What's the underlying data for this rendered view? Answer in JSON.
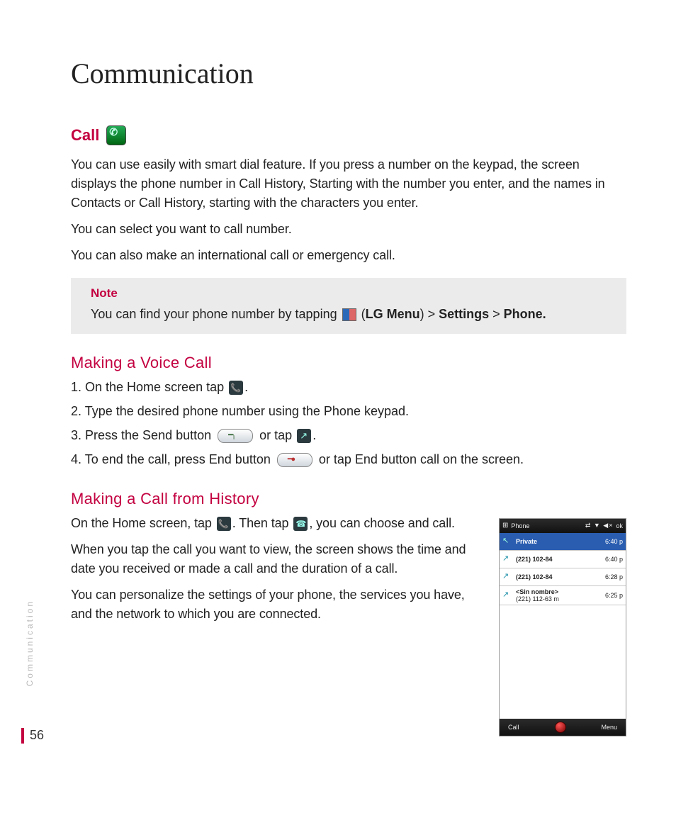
{
  "title": "Communication",
  "section_call": {
    "heading": "Call",
    "p1": "You can use easily with smart dial feature. If you press a number on the keypad, the screen displays the phone number in Call History, Starting with the number you enter, and the names in Contacts or Call History, starting with the characters you enter.",
    "p2": "You can select you want to call number.",
    "p3": "You can also make an international call or emergency call."
  },
  "note": {
    "label": "Note",
    "pre": "You can find your phone number by tapping ",
    "lg_menu": "LG Menu",
    "settings": "Settings",
    "phone": "Phone."
  },
  "voice_call": {
    "heading": "Making a Voice Call",
    "s1a": "1. On the Home screen tap ",
    "s1b": ".",
    "s2": "2. Type the desired phone number using the Phone keypad.",
    "s3a": "3. Press the Send button  ",
    "s3b": " or tap ",
    "s3c": ".",
    "s4a": "4. To end the call, press End button  ",
    "s4b": " or tap End button  call on the screen."
  },
  "history_call": {
    "heading": "Making a Call from History",
    "p1a": "On the Home screen, tap ",
    "p1b": ". Then tap  ",
    "p1c": ", you can choose and call.",
    "p2": "When you tap the call you want to view, the screen shows the time and date you received or made a call and the duration of a call.",
    "p3": "You can personalize the settings of your phone, the services you have, and the network to which you are connected."
  },
  "phone_mock": {
    "status_title": "Phone",
    "status_ok": "ok",
    "rows": [
      {
        "name": "Private",
        "time": "6:40 p"
      },
      {
        "name": "(221) 102-84",
        "time": "6:40 p"
      },
      {
        "name": "(221) 102-84",
        "time": "6:28 p"
      },
      {
        "name_bold": "<Sin nombre>",
        "name_rest": "(221) 112-63 m",
        "time": "6:25 p"
      }
    ],
    "bottom_left": "Call",
    "bottom_right": "Menu"
  },
  "side_label": "Communication",
  "page_number": "56"
}
